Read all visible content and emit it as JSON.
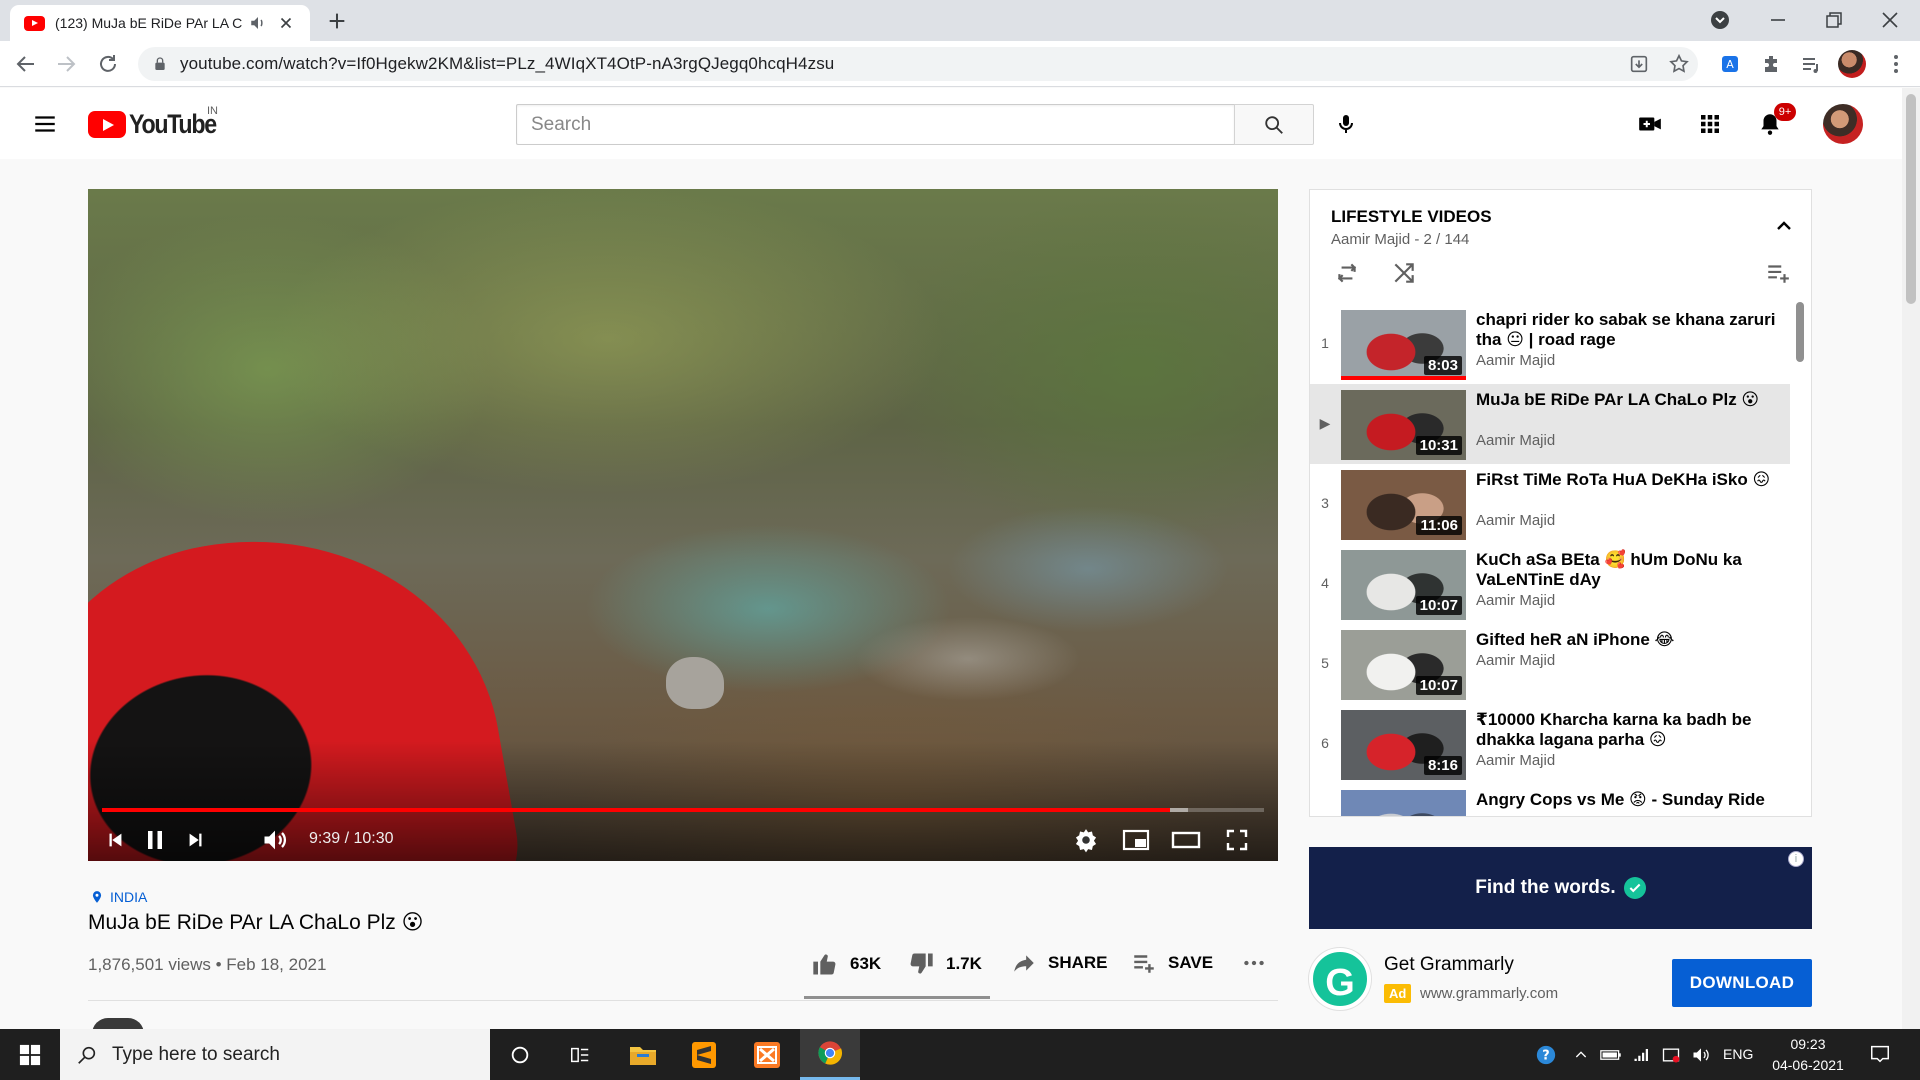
{
  "browser": {
    "tab_title": "(123) MuJa bE RiDe PAr LA C",
    "url": "youtube.com/watch?v=If0Hgekw2KM&list=PLz_4WIqXT4OtP-nA3rgQJegq0hcqH4zsu"
  },
  "masthead": {
    "logo_text": "YouTube",
    "country": "IN",
    "search_placeholder": "Search",
    "notification_count": "9+"
  },
  "player": {
    "time": "9:39 / 10:30",
    "progress_fraction": 0.919,
    "buffered_fraction": 0.935,
    "state": "playing"
  },
  "video": {
    "location": "INDIA",
    "title": "MuJa bE RiDe PAr LA ChaLo Plz 😮",
    "meta": "1,876,501 views • Feb 18, 2021",
    "likes": "63K",
    "dislikes": "1.7K",
    "share_label": "SHARE",
    "save_label": "SAVE",
    "like_ratio": 0.974
  },
  "playlist": {
    "title": "LIFESTYLE VIDEOS",
    "subtitle": "Aamir Majid - 2 / 144",
    "items": [
      {
        "index": "1",
        "title": "chapri rider ko sabak se khana zaruri tha 😐 | road rage",
        "channel": "Aamir Majid",
        "duration": "8:03",
        "watched_fraction": 1.0,
        "colors": [
          "#9aa1a6",
          "#c4242a",
          "#3b3b3b"
        ]
      },
      {
        "index": "▶",
        "title": "MuJa bE RiDe PAr LA ChaLo Plz 😮",
        "channel": "Aamir Majid",
        "duration": "10:31",
        "watched_fraction": 0,
        "colors": [
          "#6b6a5c",
          "#c51b21",
          "#2a2a2a"
        ]
      },
      {
        "index": "3",
        "title": "FiRst TiMe RoTa HuA DeKHa iSko 😖",
        "channel": "Aamir Majid",
        "duration": "11:06",
        "watched_fraction": 0,
        "colors": [
          "#7a5a44",
          "#3a2a22",
          "#c99f86"
        ]
      },
      {
        "index": "4",
        "title": "KuCh aSa BEta 🥰 hUm DoNu ka VaLeNTinE dAy",
        "channel": "Aamir Majid",
        "duration": "10:07",
        "watched_fraction": 0,
        "colors": [
          "#8e9896",
          "#e7e7e5",
          "#2f3332"
        ]
      },
      {
        "index": "5",
        "title": "Gifted heR aN iPhone 😂",
        "channel": "Aamir Majid",
        "duration": "10:07",
        "watched_fraction": 0,
        "colors": [
          "#9b9e97",
          "#f1f1ef",
          "#2a2a2a"
        ]
      },
      {
        "index": "6",
        "title": "₹10000 Kharcha karna ka badh be dhakka lagana parha 😖",
        "channel": "Aamir Majid",
        "duration": "8:16",
        "watched_fraction": 0,
        "colors": [
          "#5c5f62",
          "#d6232a",
          "#1f1f1f"
        ]
      },
      {
        "index": "7",
        "title": "Angry Cops vs Me 😡 - Sunday Ride",
        "channel": "Aamir Majid",
        "duration": "",
        "watched_fraction": 0,
        "colors": [
          "#6f88b6",
          "#c8cbd1",
          "#3e4a60"
        ]
      }
    ]
  },
  "ad": {
    "banner_text": "Find the words.",
    "title": "Get Grammarly",
    "tag": "Ad",
    "domain": "www.grammarly.com",
    "cta": "DOWNLOAD",
    "logo_letter": "G"
  },
  "taskbar": {
    "search_placeholder": "Type here to search",
    "language": "ENG",
    "time": "09:23",
    "date": "04-06-2021"
  }
}
